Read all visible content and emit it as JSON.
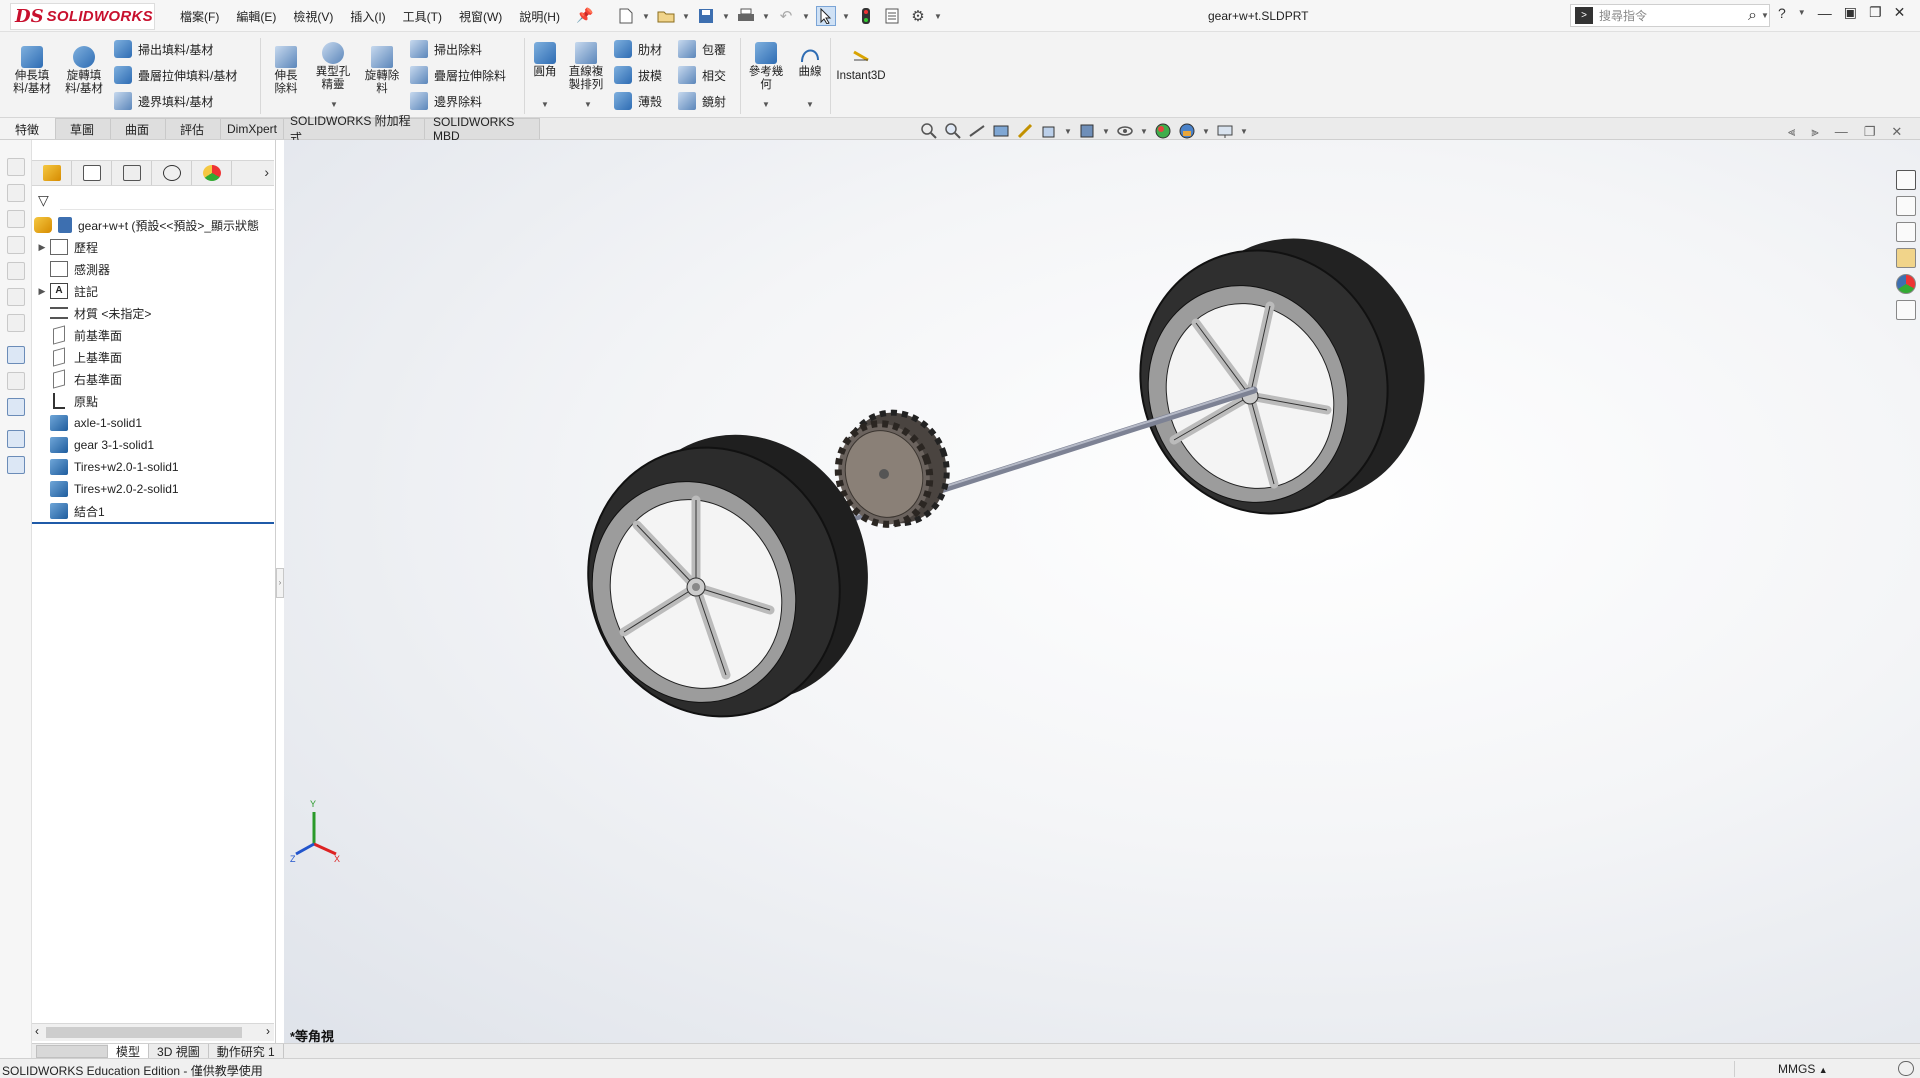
{
  "app": {
    "logo_mark": "DS",
    "logo_name": "SOLIDWORKS",
    "document_title": "gear+w+t.SLDPRT"
  },
  "menu": [
    "檔案(F)",
    "編輯(E)",
    "檢視(V)",
    "插入(I)",
    "工具(T)",
    "視窗(W)",
    "說明(H)"
  ],
  "search": {
    "placeholder": "搜尋指令"
  },
  "ribbon": {
    "extrude_boss": "伸長填料/基材",
    "revolve_boss": "旋轉填料/基材",
    "sweep_boss": "掃出填料/基材",
    "loft_boss": "疊層拉伸填料/基材",
    "boundary_boss": "邊界填料/基材",
    "extrude_cut": "伸長除料",
    "hole_wizard": "異型孔精靈",
    "revolve_cut": "旋轉除料",
    "sweep_cut": "掃出除料",
    "loft_cut": "疊層拉伸除料",
    "boundary_cut": "邊界除料",
    "fillet": "圓角",
    "linear_pattern": "直線複製排列",
    "rib": "肋材",
    "draft": "拔模",
    "shell": "薄殼",
    "wrap": "包覆",
    "intersect": "相交",
    "mirror": "鏡射",
    "ref_geometry": "參考幾何",
    "curves": "曲線",
    "instant3d": "Instant3D"
  },
  "tabs": [
    {
      "label": "特徵",
      "active": true
    },
    {
      "label": "草圖",
      "active": false
    },
    {
      "label": "曲面",
      "active": false
    },
    {
      "label": "評估",
      "active": false
    },
    {
      "label": "DimXpert",
      "active": false
    },
    {
      "label": "SOLIDWORKS 附加程式",
      "active": false
    },
    {
      "label": "SOLIDWORKS MBD",
      "active": false
    }
  ],
  "tree": {
    "root": "gear+w+t (預設<<預設>_顯示狀態",
    "items": [
      {
        "label": "歷程",
        "icon": "history-folder-icon"
      },
      {
        "label": "感測器",
        "icon": "sensors-folder-icon"
      },
      {
        "label": "註記",
        "icon": "annotations-icon"
      },
      {
        "label": "材質 <未指定>",
        "icon": "material-icon"
      },
      {
        "label": "前基準面",
        "icon": "plane-icon"
      },
      {
        "label": "上基準面",
        "icon": "plane-icon"
      },
      {
        "label": "右基準面",
        "icon": "plane-icon"
      },
      {
        "label": "原點",
        "icon": "origin-icon"
      },
      {
        "label": "axle-1-solid1",
        "icon": "solid-body-icon"
      },
      {
        "label": "gear 3-1-solid1",
        "icon": "solid-body-icon"
      },
      {
        "label": "Tires+w2.0-1-solid1",
        "icon": "solid-body-icon"
      },
      {
        "label": "Tires+w2.0-2-solid1",
        "icon": "solid-body-icon"
      },
      {
        "label": "結合1",
        "icon": "combine-feature-icon"
      }
    ]
  },
  "viewport": {
    "view_name": "*等角視",
    "triad": {
      "x": "X",
      "y": "Y",
      "z": "Z"
    }
  },
  "bottom_tabs": [
    {
      "label": "模型",
      "active": true
    },
    {
      "label": "3D 視圖",
      "active": false
    },
    {
      "label": "動作研究 1",
      "active": false
    }
  ],
  "status": {
    "edition": "SOLIDWORKS Education Edition - 僅供教學使用",
    "units": "MMGS"
  },
  "colors": {
    "brand": "#c8102e",
    "accent": "#1f5aa8",
    "tire": "#2a2a2a",
    "rim": "#b5b5b5",
    "gear": "#6b635e",
    "axle": "#8e93a3"
  }
}
